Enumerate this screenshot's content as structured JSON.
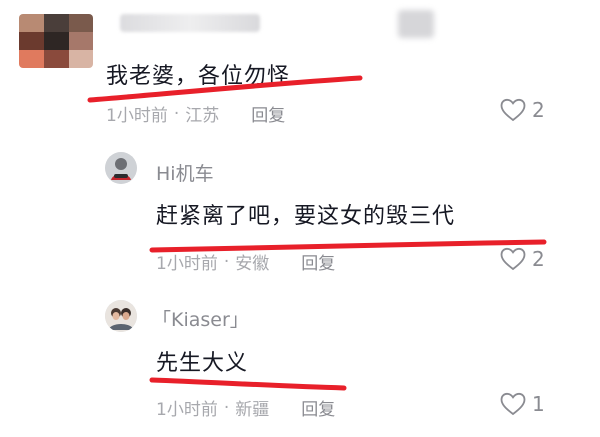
{
  "comments": [
    {
      "username": "",
      "text": "我老婆，各位勿怪",
      "time": "1小时前",
      "location": "江苏",
      "reply_label": "回复",
      "likes": "2"
    },
    {
      "username": "Hi机车",
      "text": "赶紧离了吧，要这女的毁三代",
      "time": "1小时前",
      "location": "安徽",
      "reply_label": "回复",
      "likes": "2"
    },
    {
      "username": "「Kiaser」",
      "text": "先生大义",
      "time": "1小时前",
      "location": "新疆",
      "reply_label": "回复",
      "likes": "1"
    }
  ],
  "colors": {
    "underline": "#e8202a",
    "text": "#161823",
    "meta": "#a7a8ad"
  },
  "icons": {
    "like": "heart-outline-icon"
  }
}
